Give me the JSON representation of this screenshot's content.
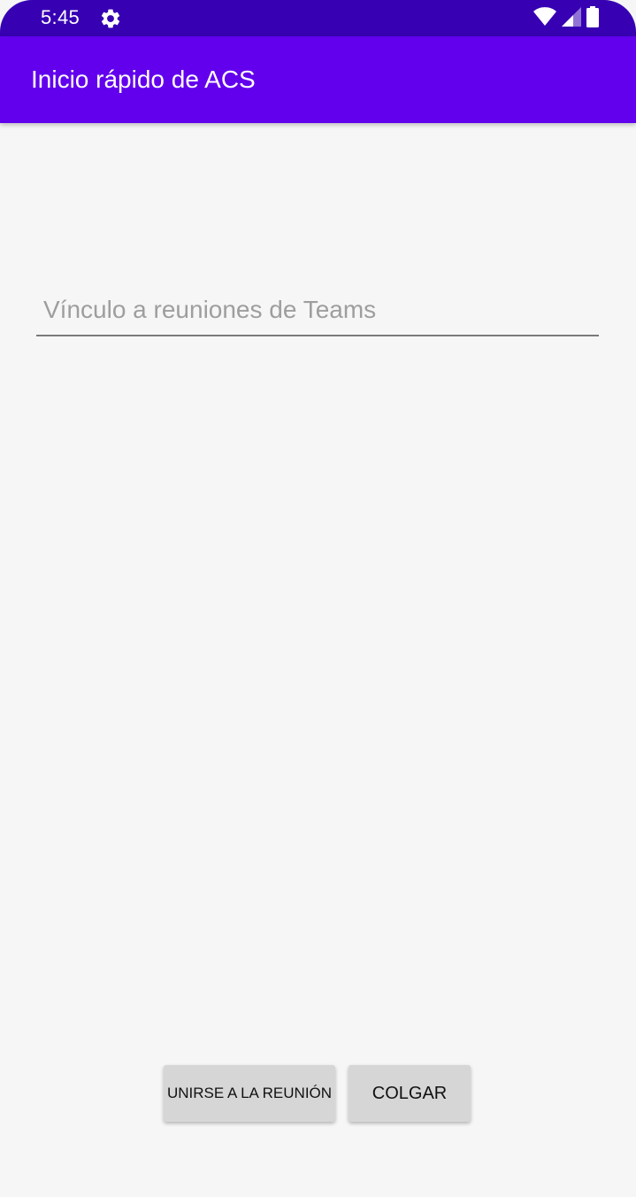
{
  "status_bar": {
    "time": "5:45",
    "settings_icon": "gear-icon",
    "wifi_icon": "wifi-icon",
    "signal_icon": "cell-signal-icon",
    "battery_icon": "battery-icon",
    "background_color": "#3700b3"
  },
  "app_bar": {
    "title": "Inicio rápido de ACS",
    "background_color": "#6200ee"
  },
  "meeting_link": {
    "placeholder": "Vínculo a reuniones de Teams",
    "value": ""
  },
  "buttons": {
    "join_label": "UNIRSE A LA REUNIÓN",
    "hangup_label": "COLGAR"
  }
}
